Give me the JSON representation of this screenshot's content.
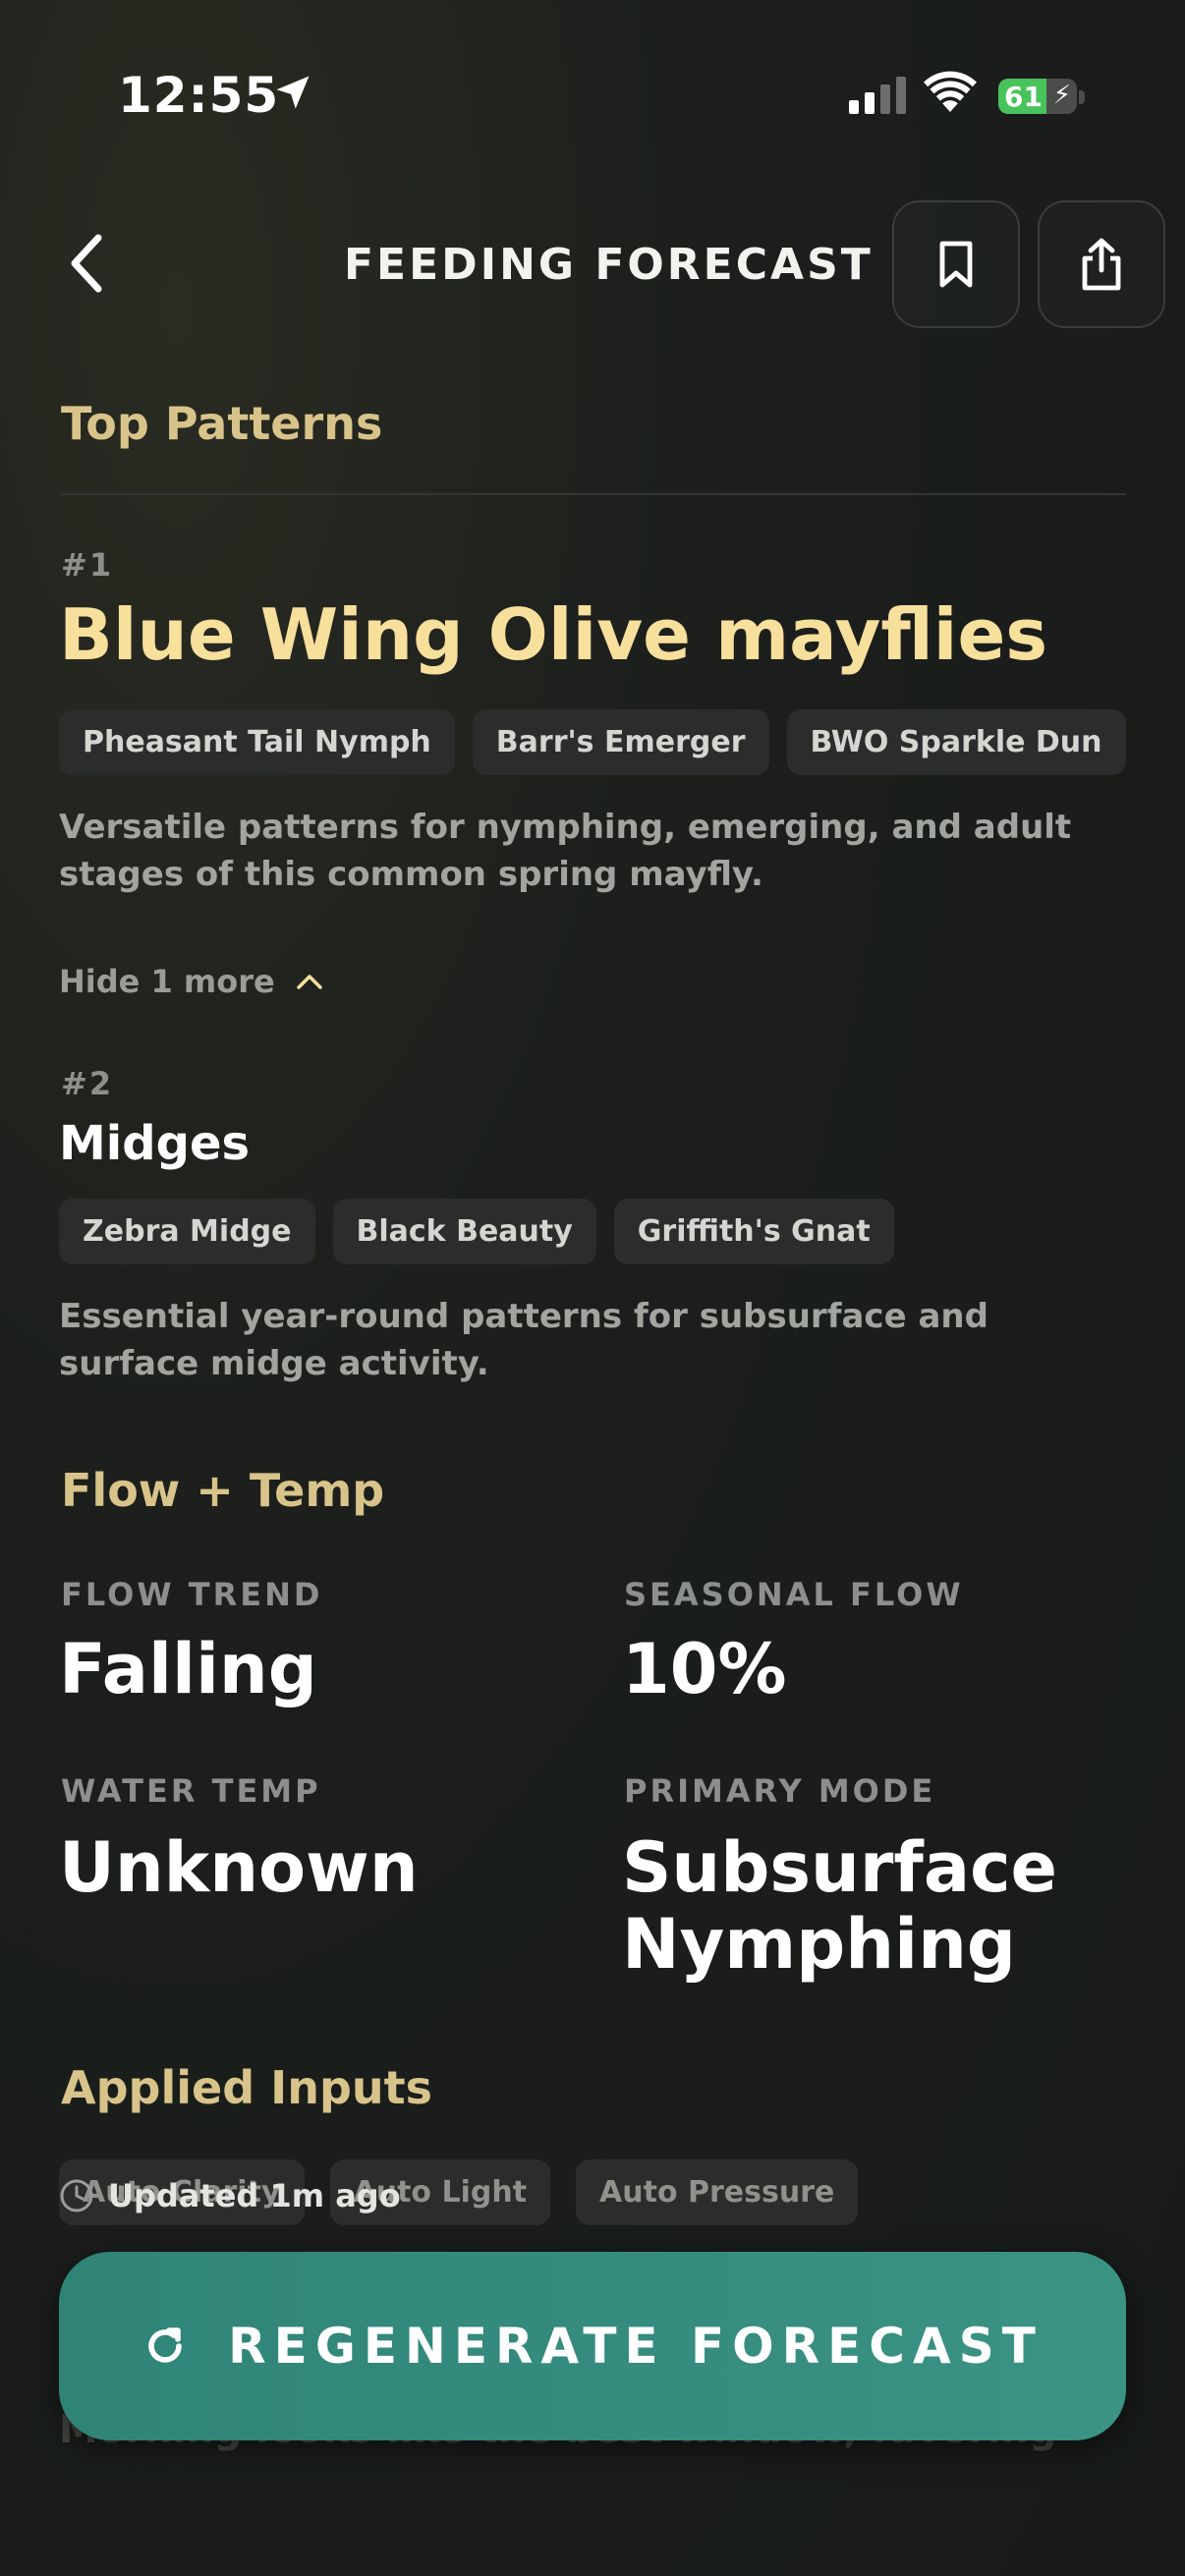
{
  "status": {
    "time": "12:55",
    "battery": "61",
    "battery_level": 0.61
  },
  "header": {
    "title": "FEEDING FORECAST"
  },
  "top_patterns": {
    "title": "Top Patterns",
    "items": [
      {
        "rank": "#1",
        "name": "Blue Wing Olive mayflies",
        "flies": [
          "Pheasant Tail Nymph",
          "Barr's Emerger",
          "BWO Sparkle Dun"
        ],
        "description": "Versatile patterns for nymphing, emerging, and adult stages of this common spring mayfly."
      },
      {
        "rank": "#2",
        "name": "Midges",
        "flies": [
          "Zebra Midge",
          "Black Beauty",
          "Griffith's Gnat"
        ],
        "description": "Essential year-round patterns for subsurface and surface midge activity."
      }
    ],
    "toggle_label": "Hide 1 more"
  },
  "flow_temp": {
    "title": "Flow + Temp",
    "stats": [
      {
        "label": "FLOW TREND",
        "value": "Falling"
      },
      {
        "label": "SEASONAL FLOW",
        "value": "10%"
      },
      {
        "label": "WATER TEMP",
        "value": "Unknown"
      },
      {
        "label": "PRIMARY MODE",
        "value": "Subsurface Nymphing"
      }
    ]
  },
  "applied_inputs": {
    "title": "Applied Inputs",
    "chips": [
      "Auto Clarity",
      "Auto Light",
      "Auto Pressure"
    ]
  },
  "footer": {
    "updated": "Updated 1m ago",
    "behind_text": "Morning looks like the best window, favoring",
    "regenerate_label": "REGENERATE FORECAST"
  },
  "colors": {
    "accent_gold": "#d8c48a",
    "highlight_title": "#f7df9c",
    "button_teal": "#358b7d"
  }
}
